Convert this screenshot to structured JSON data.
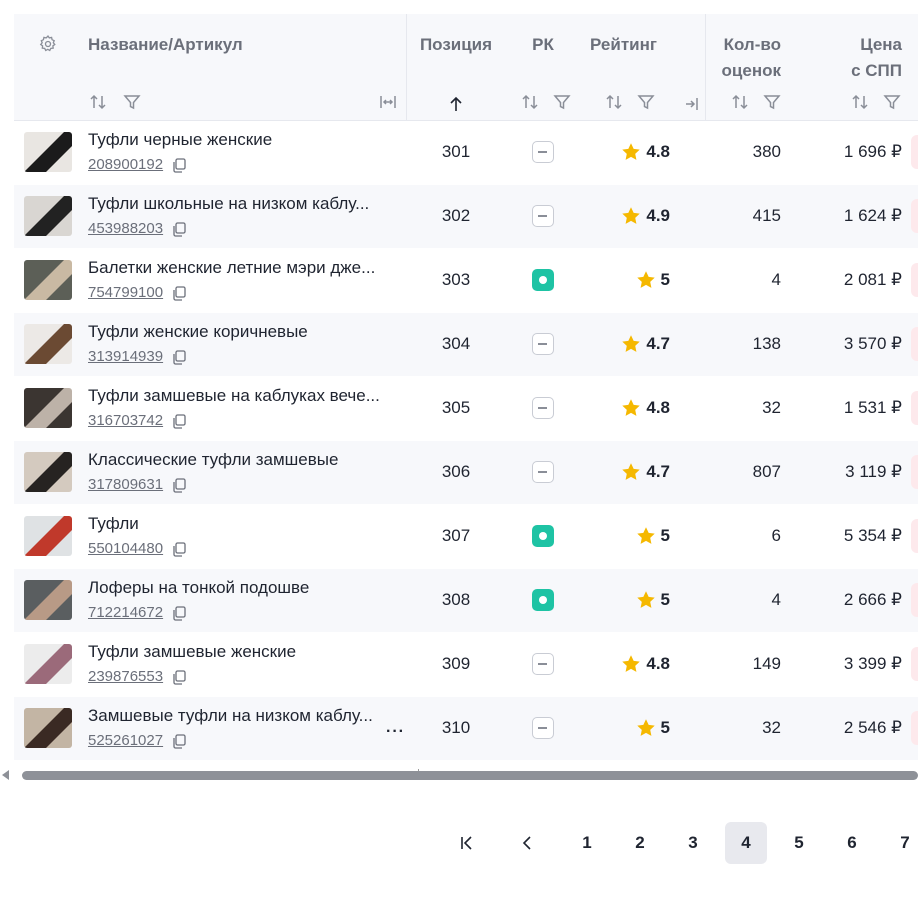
{
  "header": {
    "name": "Название/Артикул",
    "position": "Позиция",
    "rk": "РК",
    "rating": "Рейтинг",
    "reviews_line1": "Кол-во",
    "reviews_line2": "оценок",
    "price_line1": "Цена",
    "price_line2": "с СПП"
  },
  "colors": {
    "accent_green": "#1ec3a4",
    "star": "#f5b800",
    "row_alt": "#f7f8fb"
  },
  "rows": [
    {
      "name": "Туфли черные женские",
      "code": "208900192",
      "position": "301",
      "rk": false,
      "rating": "4.8",
      "count": "380",
      "price": "1 696 ₽"
    },
    {
      "name": "Туфли школьные на низком каблу...",
      "code": "453988203",
      "position": "302",
      "rk": false,
      "rating": "4.9",
      "count": "415",
      "price": "1 624 ₽"
    },
    {
      "name": "Балетки женские летние мэри дже...",
      "code": "754799100",
      "position": "303",
      "rk": true,
      "rating": "5",
      "count": "4",
      "price": "2 081 ₽"
    },
    {
      "name": "Туфли женские коричневые",
      "code": "313914939",
      "position": "304",
      "rk": false,
      "rating": "4.7",
      "count": "138",
      "price": "3 570 ₽"
    },
    {
      "name": "Туфли замшевые на каблуках вече...",
      "code": "316703742",
      "position": "305",
      "rk": false,
      "rating": "4.8",
      "count": "32",
      "price": "1 531 ₽"
    },
    {
      "name": "Классические туфли замшевые",
      "code": "317809631",
      "position": "306",
      "rk": false,
      "rating": "4.7",
      "count": "807",
      "price": "3 119 ₽"
    },
    {
      "name": "Туфли",
      "code": "550104480",
      "position": "307",
      "rk": true,
      "rating": "5",
      "count": "6",
      "price": "5 354 ₽"
    },
    {
      "name": "Лоферы на тонкой подошве",
      "code": "712214672",
      "position": "308",
      "rk": true,
      "rating": "5",
      "count": "4",
      "price": "2 666 ₽"
    },
    {
      "name": "Туфли замшевые женские",
      "code": "239876553",
      "position": "309",
      "rk": false,
      "rating": "4.8",
      "count": "149",
      "price": "3 399 ₽"
    },
    {
      "name": "Замшевые туфли на низком каблу...",
      "code": "525261027",
      "position": "310",
      "rk": false,
      "rating": "5",
      "count": "32",
      "price": "2 546 ₽"
    }
  ],
  "pagination": {
    "pages": [
      "1",
      "2",
      "3",
      "4",
      "5",
      "6",
      "7"
    ],
    "current": "4"
  }
}
